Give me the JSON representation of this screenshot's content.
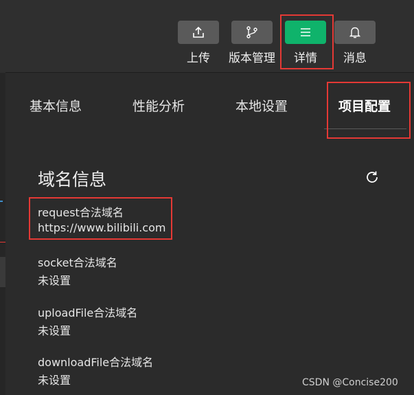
{
  "toolbar": {
    "upload_label": "上传",
    "version_label": "版本管理",
    "details_label": "详情",
    "messages_label": "消息",
    "active_color": "#0fb36b",
    "button_color": "#5a5a5a"
  },
  "tabs": [
    {
      "label": "基本信息"
    },
    {
      "label": "性能分析"
    },
    {
      "label": "本地设置"
    },
    {
      "label": "项目配置",
      "active": true
    }
  ],
  "domain_section": {
    "title": "域名信息",
    "items": [
      {
        "label": "request合法域名",
        "value": "https://www.bilibili.com"
      },
      {
        "label": "socket合法域名",
        "value": "未设置"
      },
      {
        "label": "uploadFile合法域名",
        "value": "未设置"
      },
      {
        "label": "downloadFile合法域名",
        "value": "未设置"
      }
    ]
  },
  "watermark": "CSDN @Concise200",
  "highlight_color": "#e53935"
}
